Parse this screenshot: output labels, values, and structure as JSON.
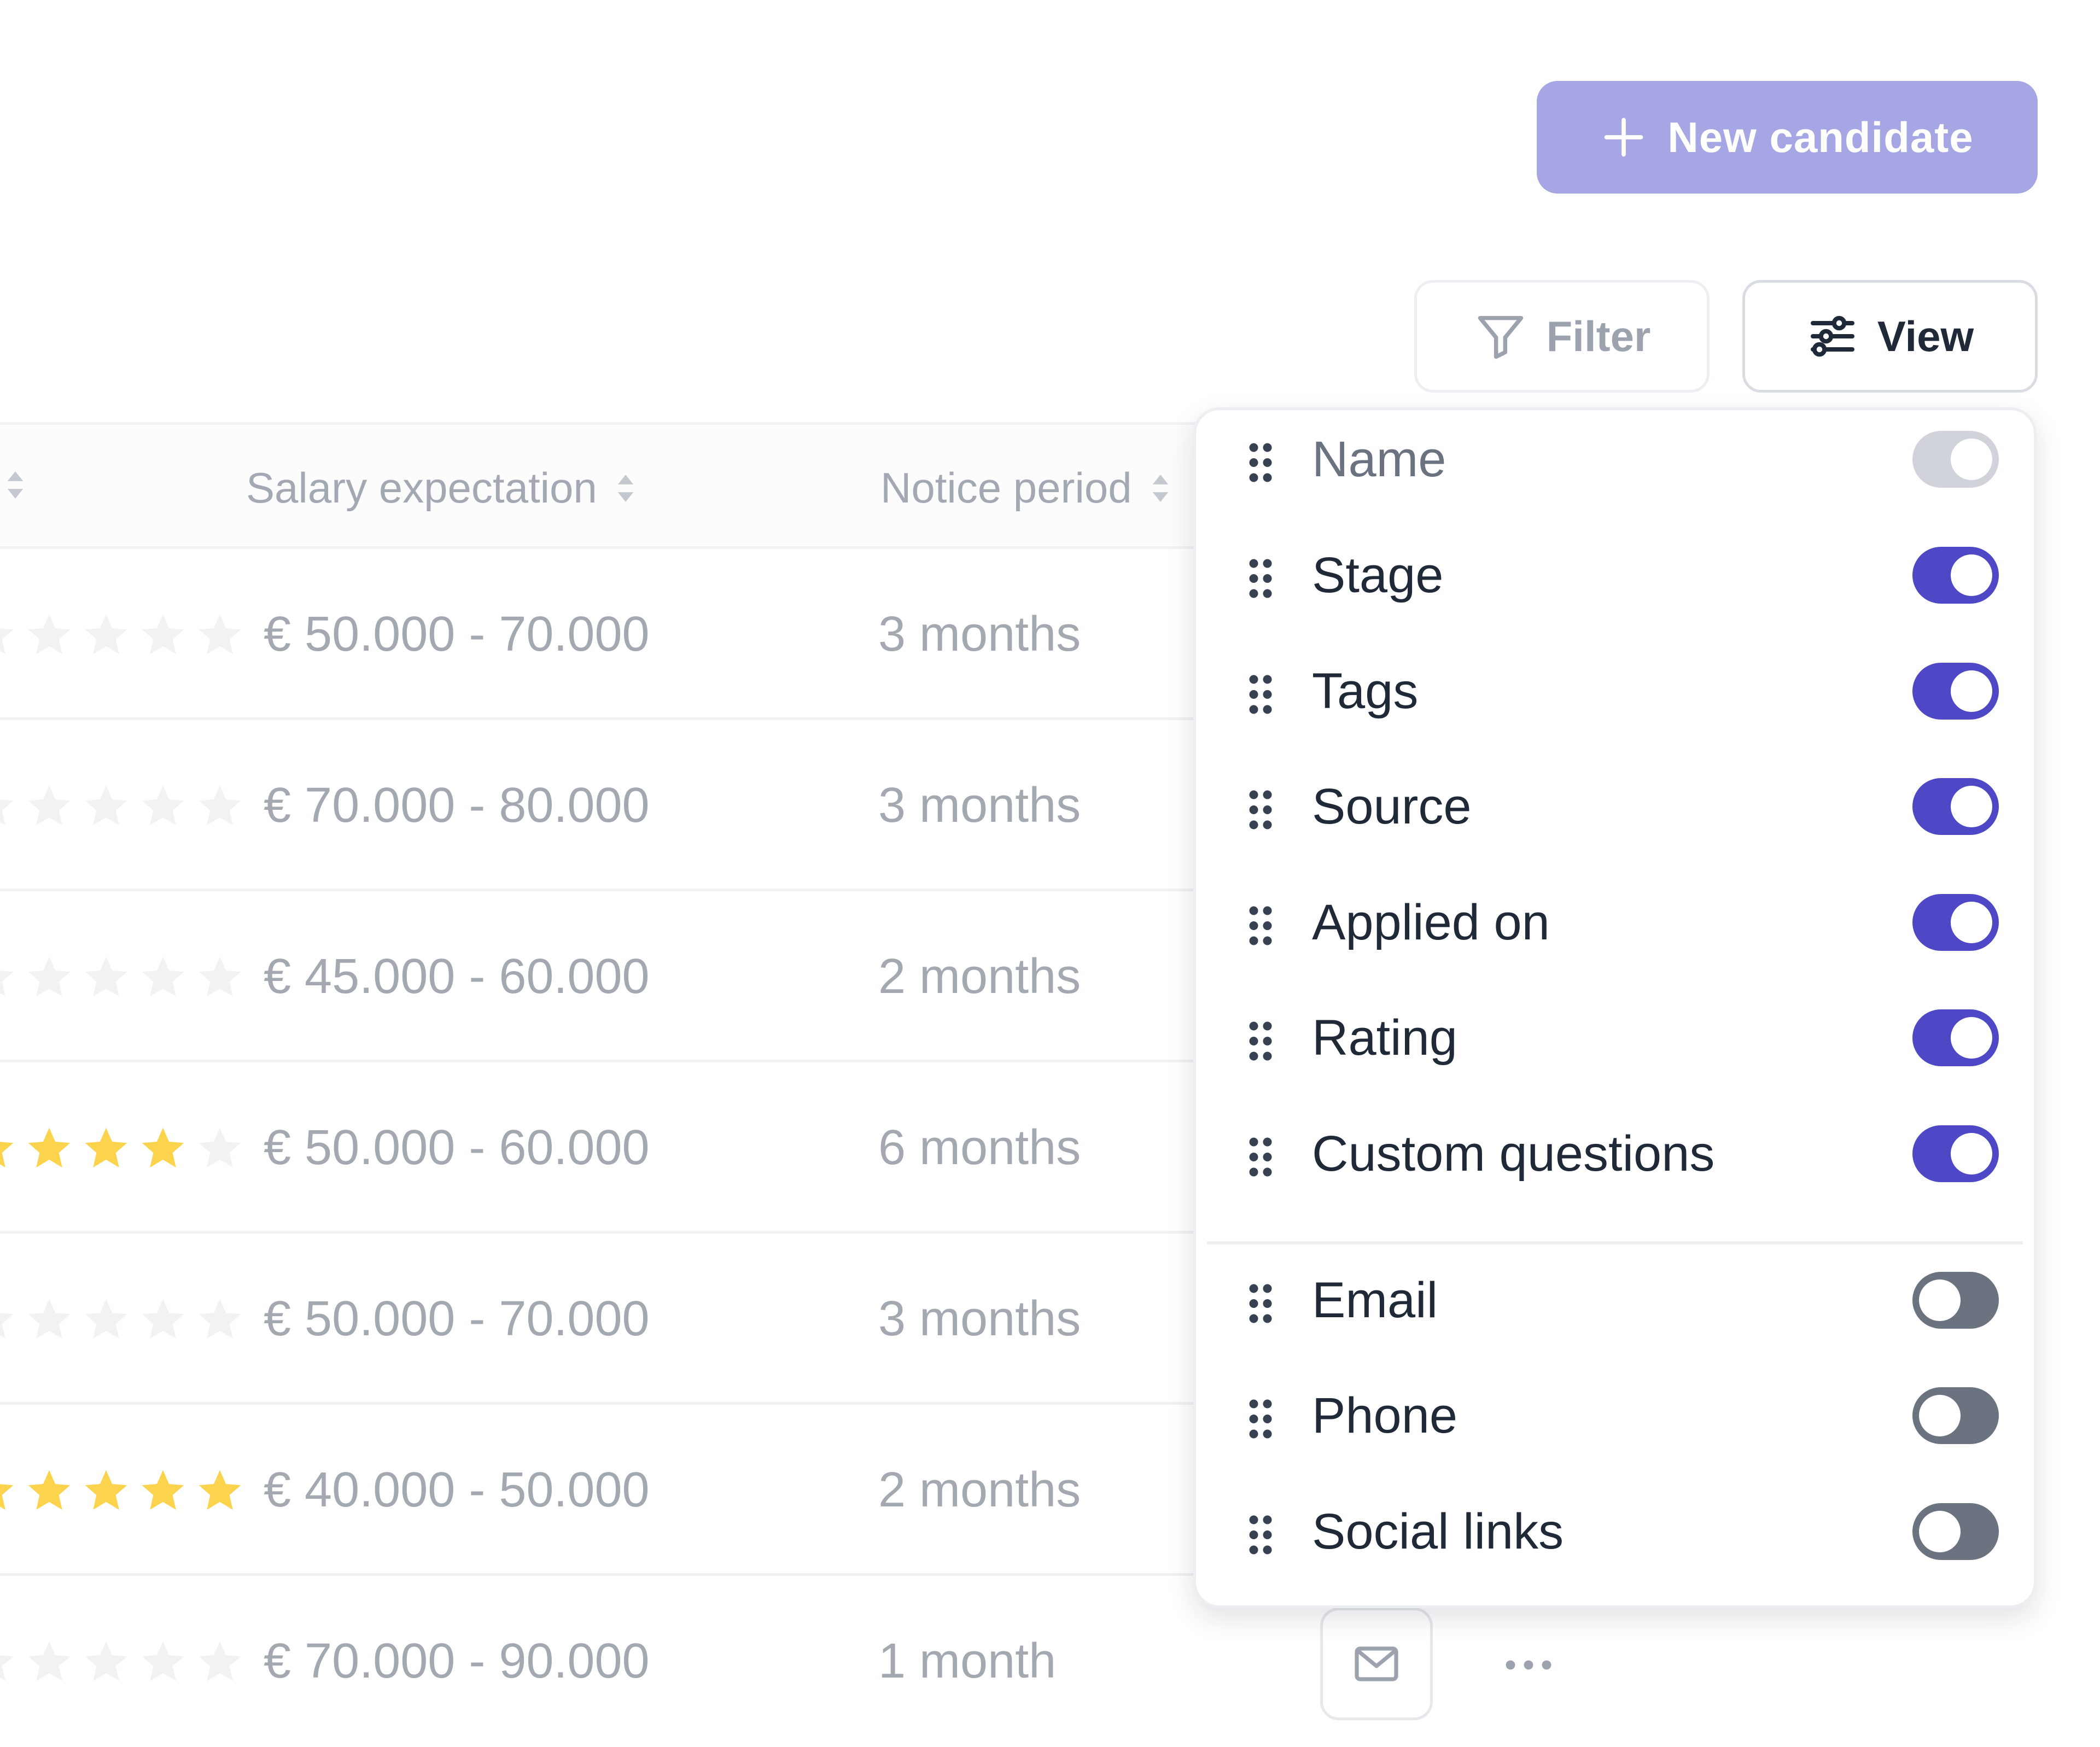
{
  "toolbar": {
    "new_candidate_label": "New candidate",
    "filter_label": "Filter",
    "view_label": "View"
  },
  "table": {
    "columns": {
      "salary_expectation": "Salary expectation",
      "notice_period": "Notice period"
    },
    "rows": [
      {
        "salary": "€ 50.000 - 70.000",
        "notice": "3 months",
        "rating": 0
      },
      {
        "salary": "€ 70.000 - 80.000",
        "notice": "3 months",
        "rating": 0
      },
      {
        "salary": "€ 45.000 - 60.000",
        "notice": "2 months",
        "rating": 0
      },
      {
        "salary": "€ 50.000 - 60.000",
        "notice": "6 months",
        "rating": 4
      },
      {
        "salary": "€ 50.000 - 70.000",
        "notice": "3 months",
        "rating": 0
      },
      {
        "salary": "€ 40.000 - 50.000",
        "notice": "2 months",
        "rating": 5
      },
      {
        "salary": "€ 70.000 - 90.000",
        "notice": "1 month",
        "rating": 0
      }
    ]
  },
  "view_menu": {
    "items": [
      {
        "label": "Name",
        "state": "locked-on"
      },
      {
        "label": "Stage",
        "state": "on"
      },
      {
        "label": "Tags",
        "state": "on"
      },
      {
        "label": "Source",
        "state": "on"
      },
      {
        "label": "Applied on",
        "state": "on"
      },
      {
        "label": "Rating",
        "state": "on"
      },
      {
        "label": "Custom questions",
        "state": "on"
      },
      {
        "label": "Email",
        "state": "off"
      },
      {
        "label": "Phone",
        "state": "off"
      },
      {
        "label": "Social links",
        "state": "off"
      }
    ]
  },
  "colors": {
    "primary_button": "#a5a6e3",
    "toggle_on": "#4f48c6",
    "toggle_off": "#6b7280",
    "star_filled": "#fcd34d",
    "star_empty": "#f1f2f4"
  },
  "icons": {
    "new_candidate": "plus-icon",
    "filter": "funnel-icon",
    "view": "sliders-icon",
    "drag": "drag-handle-icon",
    "mail": "mail-icon",
    "more": "more-horizontal-icon",
    "sort": "sort-icon",
    "star": "star-icon"
  }
}
